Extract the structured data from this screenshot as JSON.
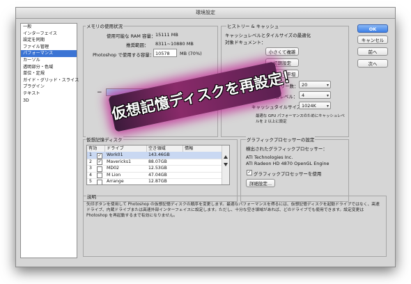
{
  "window": {
    "title": "環境設定"
  },
  "sidebar": {
    "items": [
      {
        "label": "一般"
      },
      {
        "label": "インターフェイス"
      },
      {
        "label": "設定を同期"
      },
      {
        "label": "ファイル管理"
      },
      {
        "label": "パフォーマンス",
        "selected": true
      },
      {
        "label": "カーソル"
      },
      {
        "label": "透明部分・色域"
      },
      {
        "label": "単位・定規"
      },
      {
        "label": "ガイド・グリッド・スライス"
      },
      {
        "label": "プラグイン"
      },
      {
        "label": "テキスト"
      },
      {
        "label": "3D"
      }
    ]
  },
  "memory": {
    "title": "メモリの使用状況",
    "ram_label": "使用可能な RAM 容量：",
    "ram_value": "15111 MB",
    "range_label": "推奨範囲：",
    "range_value": "8311~10880 MB",
    "use_label": "Photoshop で使用する容量：",
    "use_value": "10578",
    "use_unit": "MB (70%)",
    "minus": "−",
    "plus": "+",
    "slider_fraction": 0.7
  },
  "history": {
    "title": "ヒストリー & キャッシュ",
    "desc1": "キャッシュレベルとタイルサイズの最適化",
    "desc2": "対象ドキュメント：",
    "btn_small": "小さくて複雑",
    "btn_default": "初期設定",
    "btn_large": "大きくて平坦",
    "history_label": "ヒストリー数：",
    "history_value": "20",
    "cache_label": "キャッシュレベル：",
    "cache_value": "4",
    "tile_label": "キャッシュタイルサイズ：",
    "tile_value": "1024K",
    "note1": "最適な GPU パフォーマンスのためにキャッシュレベ",
    "note2": "ルを 2 以上に設定"
  },
  "scratch": {
    "title": "仮想記憶ディスク",
    "headers": [
      "有効",
      "ドライブ",
      "空き領域",
      "情報"
    ],
    "rows": [
      {
        "num": "1",
        "checked": true,
        "drive": "Work01",
        "free": "143.46GB",
        "info": "",
        "selected": true
      },
      {
        "num": "2",
        "checked": true,
        "drive": "Mavericks1",
        "free": "88.07GB",
        "info": ""
      },
      {
        "num": "3",
        "checked": false,
        "drive": "MD02",
        "free": "12.53GB",
        "info": ""
      },
      {
        "num": "4",
        "checked": false,
        "drive": "M Lion",
        "free": "47.04GB",
        "info": ""
      },
      {
        "num": "5",
        "checked": false,
        "drive": "Arrange",
        "free": "12.87GB",
        "info": ""
      }
    ]
  },
  "gpu": {
    "title": "グラフィックプロセッサーの設定",
    "detected": "検出されたグラフィックプロセッサー：",
    "line1": "ATI Technologies Inc.",
    "line2": "ATI Radeon HD 4870 OpenGL Engine",
    "use_label": "グラフィックプロセッサーを使用",
    "advanced": "詳細設定..."
  },
  "description": {
    "title": "説明",
    "line1": "矢印ボタンを使用して Photoshop の仮想記憶ディスクの順序を変更します。最適なパフォーマンスを得るには、仮想記憶ディスクを起動ドライブではなく、高速ドライブ、内蔵ドライブまたは高速外部インターフェイスに設定します。ただし、十分な空き領域があれば、どのドライブでも使用できます。設定変更は Photoshop を再起動するまで有効になりません。"
  },
  "buttons": {
    "ok": "OK",
    "cancel": "キャンセル",
    "prev": "前へ",
    "next": "次へ"
  },
  "overlay": {
    "text": "仮想記憶ディスクを再設定！"
  }
}
